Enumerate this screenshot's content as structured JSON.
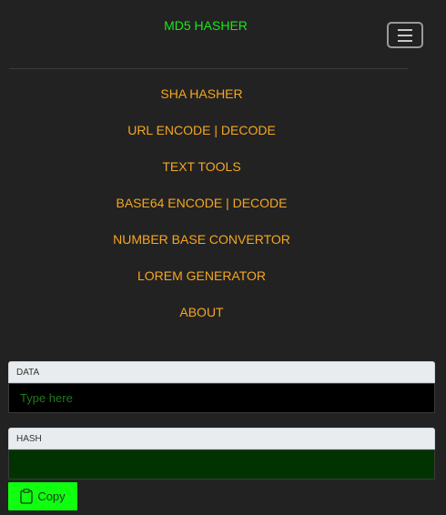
{
  "navbar": {
    "brand": "MD5 HASHER",
    "toggler_icon": "hamburger-menu-icon"
  },
  "nav": {
    "items": [
      {
        "label": "SHA HASHER"
      },
      {
        "label": "URL ENCODE | DECODE"
      },
      {
        "label": "TEXT TOOLS"
      },
      {
        "label": "BASE64 ENCODE | DECODE"
      },
      {
        "label": "NUMBER BASE CONVERTOR"
      },
      {
        "label": "LOREM GENERATOR"
      },
      {
        "label": "ABOUT"
      }
    ]
  },
  "form": {
    "data_label": "DATA",
    "data_placeholder": "Type here",
    "data_value": "",
    "hash_label": "HASH",
    "hash_value": "",
    "copy_label": "Copy",
    "copy_icon": "clipboard-icon"
  },
  "colors": {
    "background": "#222222",
    "brand": "#18e818",
    "nav_link": "#f5a623",
    "input_bg": "#000000",
    "hash_bg": "#003300",
    "copy_button": "#10ff10"
  }
}
